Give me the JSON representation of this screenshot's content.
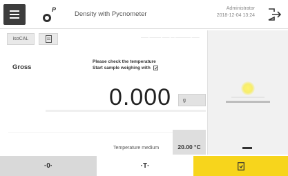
{
  "header": {
    "title": "Density with Pycnometer",
    "method_letter": "P",
    "user": "Administrator",
    "datetime": "2018-12-04  13:24"
  },
  "controls": {
    "isocal_label": "isoCAL"
  },
  "main": {
    "faint_text": "—— ——— —— — ———— ——",
    "label": "Gross",
    "instruction_line1": "Please check the temperature",
    "instruction_line2": "Start sample weighing with",
    "weight_value": "0.000",
    "unit_label": "g",
    "temperature_label": "Temperature medium",
    "temperature_value": "20.00 °C"
  },
  "buttons": {
    "zero_label": "·0·",
    "tare_label": "·T·"
  },
  "colors": {
    "accent_yellow": "#f7d51c",
    "menu_dark": "#3c3c3c"
  },
  "icons": [
    "menu-icon",
    "method-icon",
    "logout-icon",
    "document-icon",
    "complete-icon"
  ]
}
